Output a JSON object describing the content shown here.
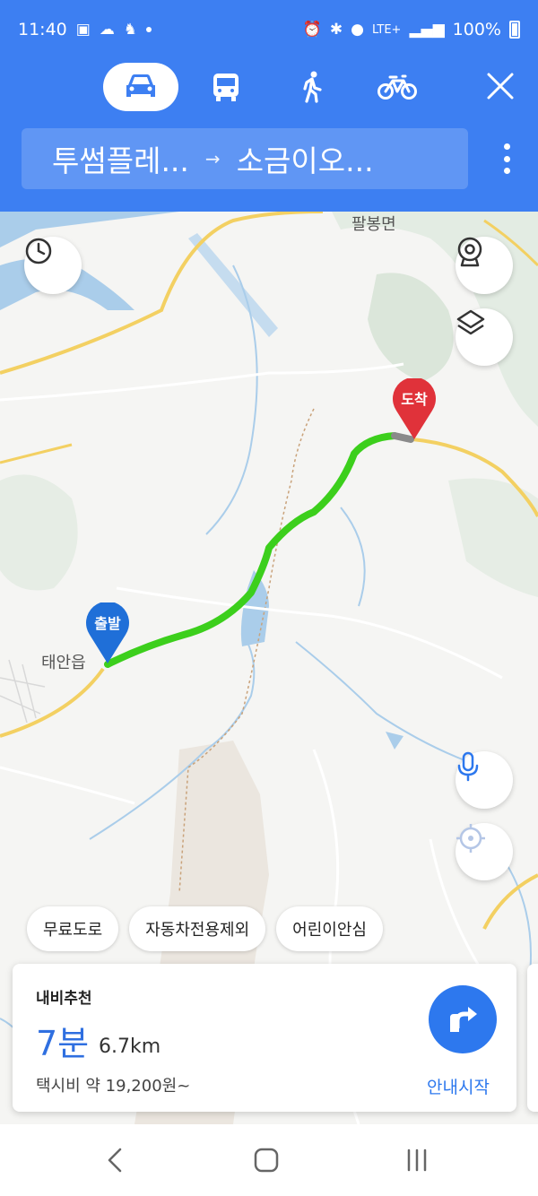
{
  "status": {
    "time": "11:40",
    "network": "LTE+",
    "battery": "100%"
  },
  "modes": [
    {
      "name": "car",
      "active": true
    },
    {
      "name": "bus",
      "active": false
    },
    {
      "name": "walk",
      "active": false
    },
    {
      "name": "bike",
      "active": false
    }
  ],
  "route": {
    "origin": "투썸플레...",
    "arrow": "→",
    "destination": "소금이오..."
  },
  "map": {
    "labels": {
      "top_town": "팔봉면",
      "left_town": "태안읍"
    },
    "start_pin": "출발",
    "end_pin": "도착",
    "route_color": "#3ccf1c"
  },
  "chips": [
    "무료도로",
    "자동차전용제외",
    "어린이안심"
  ],
  "card": {
    "title": "내비추천",
    "time": "7분",
    "distance": "6.7km",
    "fare": "택시비 약 19,200원~",
    "start_label": "안내시작"
  },
  "colors": {
    "header": "#3d7ff2",
    "accent": "#2d78ee"
  }
}
